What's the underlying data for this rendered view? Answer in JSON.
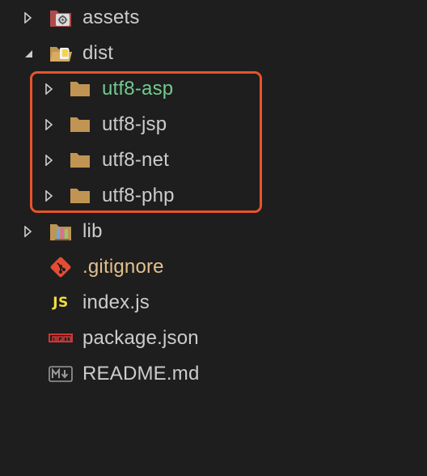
{
  "explorer": {
    "items": [
      {
        "label": "assets",
        "expanded": false,
        "icon": "folder-assets-icon",
        "color": "#cccccc"
      },
      {
        "label": "dist",
        "expanded": true,
        "icon": "folder-dist-open-icon",
        "color": "#cccccc"
      },
      {
        "label": "utf8-asp",
        "expanded": false,
        "icon": "folder-icon",
        "color": "#73c991"
      },
      {
        "label": "utf8-jsp",
        "expanded": false,
        "icon": "folder-icon",
        "color": "#cccccc"
      },
      {
        "label": "utf8-net",
        "expanded": false,
        "icon": "folder-icon",
        "color": "#cccccc"
      },
      {
        "label": "utf8-php",
        "expanded": false,
        "icon": "folder-icon",
        "color": "#cccccc"
      },
      {
        "label": "lib",
        "expanded": false,
        "icon": "folder-lib-icon",
        "color": "#cccccc"
      },
      {
        "label": ".gitignore",
        "icon": "git-icon",
        "color": "#e2c08d"
      },
      {
        "label": "index.js",
        "icon": "javascript-icon",
        "icon_text": "JS",
        "color": "#cccccc"
      },
      {
        "label": "package.json",
        "icon": "npm-icon",
        "color": "#cccccc"
      },
      {
        "label": "README.md",
        "icon": "markdown-icon",
        "color": "#cccccc"
      }
    ]
  },
  "colors": {
    "background": "#1e1e1e",
    "text": "#cccccc",
    "modified_green": "#73c991",
    "ignored_yellow": "#e2c08d",
    "highlight_border": "#e8542a",
    "folder": "#c09553",
    "js_yellow": "#f1dd3f",
    "npm_red": "#cb3837",
    "git_red": "#e44d33"
  }
}
